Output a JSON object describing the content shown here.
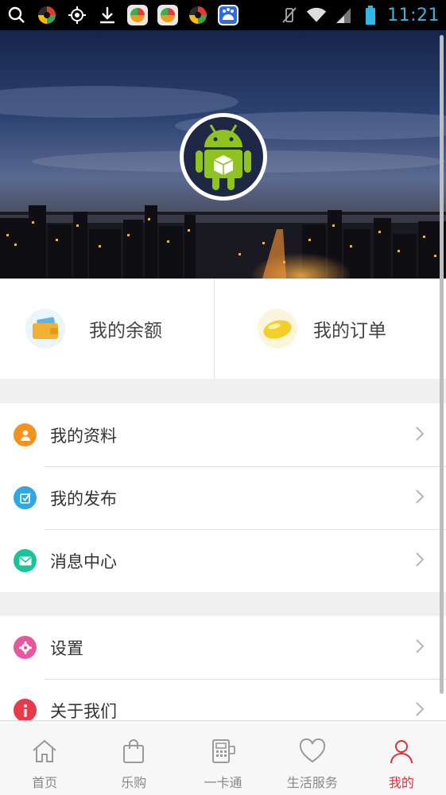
{
  "status_bar": {
    "time": "11:21",
    "left_icons": [
      "search-icon",
      "app-icon",
      "location-icon",
      "download-icon",
      "app-icon",
      "app-icon",
      "app-icon",
      "baidu-icon"
    ],
    "right_icons": [
      "vibrate-icon",
      "wifi-icon",
      "signal-icon",
      "battery-icon"
    ]
  },
  "profile": {
    "avatar_icon": "android-avatar-icon"
  },
  "quick_actions": [
    {
      "label": "我的余额",
      "icon": "wallet-icon",
      "color": "#f2b132"
    },
    {
      "label": "我的订单",
      "icon": "order-icon",
      "color": "#f4cf2a"
    }
  ],
  "menu_group_1": [
    {
      "label": "我的资料",
      "icon": "person-icon",
      "color": "#f5921e"
    },
    {
      "label": "我的发布",
      "icon": "publish-icon",
      "color": "#2fa6e6"
    },
    {
      "label": "消息中心",
      "icon": "mail-icon",
      "color": "#18c49a"
    }
  ],
  "menu_group_2": [
    {
      "label": "设置",
      "icon": "settings-icon",
      "color": "#e8569b"
    },
    {
      "label": "关于我们",
      "icon": "info-icon",
      "color": "#e83a4a"
    }
  ],
  "tabs": [
    {
      "label": "首页",
      "icon": "home-icon",
      "active": false
    },
    {
      "label": "乐购",
      "icon": "shopping-bag-icon",
      "active": false
    },
    {
      "label": "一卡通",
      "icon": "card-reader-icon",
      "active": false
    },
    {
      "label": "生活服务",
      "icon": "heart-icon",
      "active": false
    },
    {
      "label": "我的",
      "icon": "person-outline-icon",
      "active": true
    }
  ],
  "colors": {
    "accent": "#d8323c",
    "clock": "#33b5e5",
    "divider": "#e0e0e0"
  }
}
